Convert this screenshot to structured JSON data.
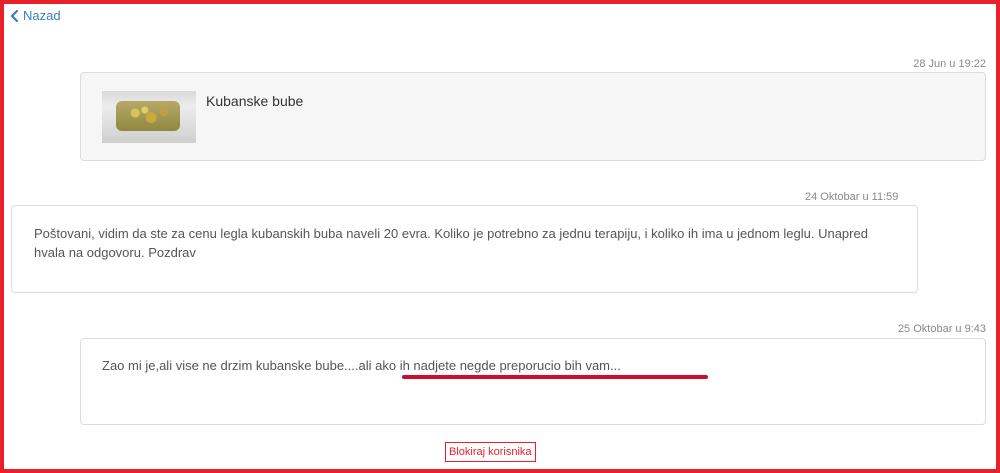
{
  "nav": {
    "back_label": "Nazad",
    "back_icon": "chevron-left-icon"
  },
  "messages": [
    {
      "timestamp": "28 Jun u 19:22",
      "type": "product",
      "product_name": "Kubanske bube",
      "image_icon": "product-thumbnail"
    },
    {
      "timestamp": "24 Oktobar u 11:59",
      "type": "text",
      "text": "Poštovani, vidim da ste za cenu legla kubanskih buba naveli 20 evra. Koliko je potrebno za jednu terapiju, i koliko ih ima u jednom leglu. Unapred hvala na odgovoru. Pozdrav"
    },
    {
      "timestamp": "25 Oktobar u 9:43",
      "type": "text",
      "text": "Zao mi je,ali vise ne drzim kubanske bube....ali ako ih nadjete negde preporucio bih vam..."
    }
  ],
  "actions": {
    "block_label": "Blokiraj korisnika"
  },
  "colors": {
    "accent": "#3a7fc1",
    "highlight": "#e8202a",
    "underline": "#c8102e"
  }
}
